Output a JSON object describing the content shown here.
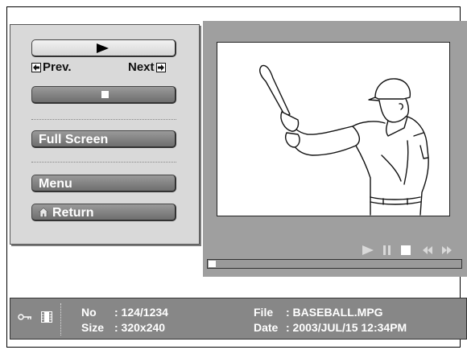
{
  "panel": {
    "prev_label": "Prev.",
    "next_label": "Next",
    "full_screen_label": "Full Screen",
    "menu_label": "Menu",
    "return_label": "Return"
  },
  "playback": {
    "progress_fraction": 0.03
  },
  "info": {
    "no_label": "No",
    "no_value": ": 124/1234",
    "size_label": "Size",
    "size_value": ": 320x240",
    "file_label": "File",
    "file_value": ": BASEBALL.MPG",
    "date_label": "Date",
    "date_value": ": 2003/JUL/15 12:34PM"
  },
  "icons": [
    "play-icon",
    "stop-icon",
    "prev-arrow-icon",
    "next-arrow-icon",
    "home-icon",
    "pause-icon",
    "rewind-icon",
    "fast-forward-icon",
    "key-icon",
    "film-icon"
  ]
}
